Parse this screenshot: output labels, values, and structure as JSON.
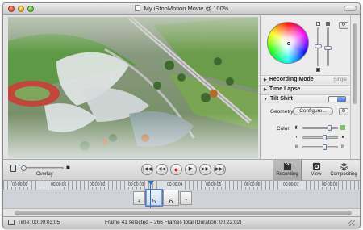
{
  "window": {
    "title": "My iStopMotion Movie @ 100%"
  },
  "inspector": {
    "sections": {
      "recording_mode": {
        "label": "Recording Mode",
        "value": "Single"
      },
      "time_lapse": {
        "label": "Time Lapse"
      },
      "tilt_shift": {
        "label": "Tilt Shift"
      }
    },
    "geometry_label": "Geometry:",
    "configure_label": "Configure...",
    "color_label": "Color:"
  },
  "controls": {
    "overlay_label": "Overlay",
    "tabs": [
      {
        "label": "Recording"
      },
      {
        "label": "View"
      },
      {
        "label": "Compositing"
      }
    ]
  },
  "timeline": {
    "ticks": [
      "00:00:00",
      "00:00:01",
      "00:00:02",
      "00:00:03",
      "00:00:04",
      "00:00:05",
      "00:00:06",
      "00:00:07",
      "00:00:08"
    ],
    "frames": [
      "4",
      "5",
      "6",
      "7"
    ],
    "current_frame": "5"
  },
  "status": {
    "time": "Time: 00:00:03:05",
    "frame_info": "Frame 41 selected – 266 Frames total (Duration: 00:22:02)"
  }
}
